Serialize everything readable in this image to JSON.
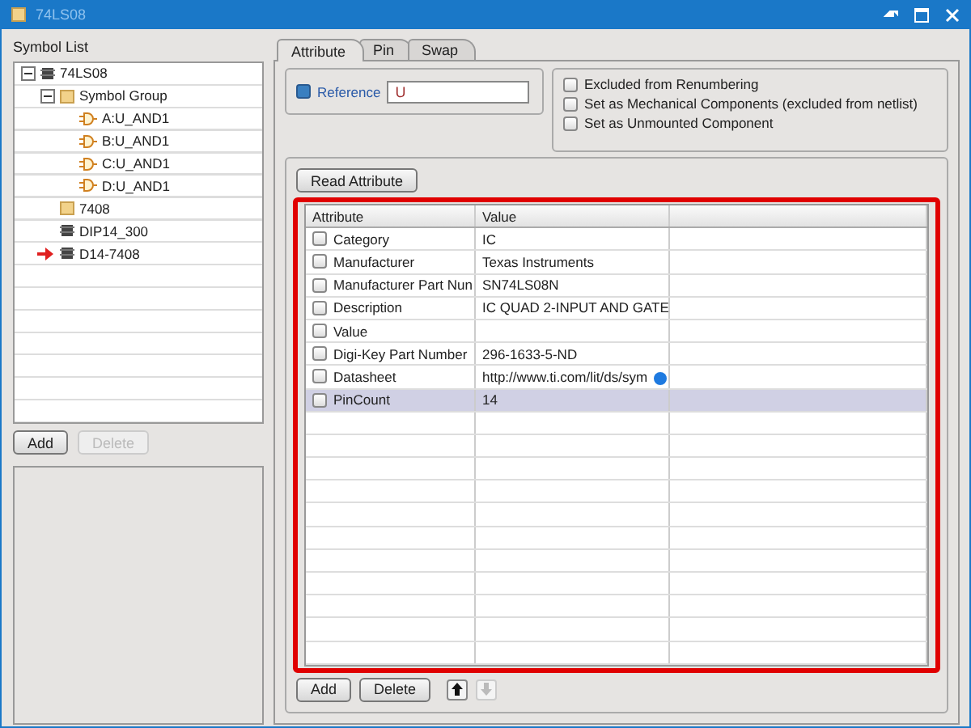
{
  "window": {
    "title": "74LS08"
  },
  "symbol_list": {
    "label": "Symbol List",
    "items": [
      {
        "label": "74LS08",
        "kind": "chip",
        "expanded": true,
        "marked": false,
        "children": [
          {
            "label": "Symbol Group",
            "kind": "folder",
            "expanded": true,
            "marked": false,
            "children": [
              {
                "label": "A:U_AND1",
                "kind": "gate",
                "marked": false
              },
              {
                "label": "B:U_AND1",
                "kind": "gate",
                "marked": false
              },
              {
                "label": "C:U_AND1",
                "kind": "gate",
                "marked": false
              },
              {
                "label": "D:U_AND1",
                "kind": "gate",
                "marked": false
              }
            ]
          },
          {
            "label": "7408",
            "kind": "folder",
            "marked": false
          },
          {
            "label": "DIP14_300",
            "kind": "chip",
            "marked": false
          },
          {
            "label": "D14-7408",
            "kind": "chip",
            "marked": true
          }
        ]
      }
    ],
    "buttons": [
      {
        "label": "Add",
        "disabled": false
      },
      {
        "label": "Delete",
        "disabled": true
      }
    ]
  },
  "tabs": [
    {
      "label": "Attribute",
      "selected": true
    },
    {
      "label": "Pin",
      "selected": false
    },
    {
      "label": "Swap",
      "selected": false
    }
  ],
  "reference": {
    "label": "Reference",
    "checked": true,
    "value": "U"
  },
  "options": [
    {
      "label": "Excluded from Renumbering",
      "checked": false
    },
    {
      "label": "Set as Mechanical Components (excluded from netlist)",
      "checked": false
    },
    {
      "label": "Set as Unmounted Component",
      "checked": false
    }
  ],
  "read_button": "Read Attribute",
  "table": {
    "columns": [
      "Attribute",
      "Value"
    ],
    "rows": [
      {
        "attribute": "Category",
        "value": "IC",
        "checked": false,
        "selected": false
      },
      {
        "attribute": "Manufacturer",
        "value": "Texas Instruments",
        "checked": false,
        "selected": false
      },
      {
        "attribute": "Manufacturer Part Nun",
        "value": "SN74LS08N",
        "checked": false,
        "selected": false
      },
      {
        "attribute": "Description",
        "value": "IC QUAD 2-INPUT AND GATE",
        "checked": false,
        "selected": false
      },
      {
        "attribute": "Value",
        "value": "",
        "checked": false,
        "selected": false
      },
      {
        "attribute": "Digi-Key Part Number",
        "value": "296-1633-5-ND",
        "checked": false,
        "selected": false
      },
      {
        "attribute": "Datasheet",
        "value": "http://www.ti.com/lit/ds/sym",
        "checked": false,
        "selected": false,
        "link_icon": true
      },
      {
        "attribute": "PinCount",
        "value": "14",
        "checked": false,
        "selected": true
      }
    ]
  },
  "bottom_buttons": [
    {
      "label": "Add",
      "disabled": false
    },
    {
      "label": "Delete",
      "disabled": false
    }
  ],
  "move_buttons": [
    {
      "kind": "up",
      "disabled": false
    },
    {
      "kind": "down",
      "disabled": true
    }
  ]
}
